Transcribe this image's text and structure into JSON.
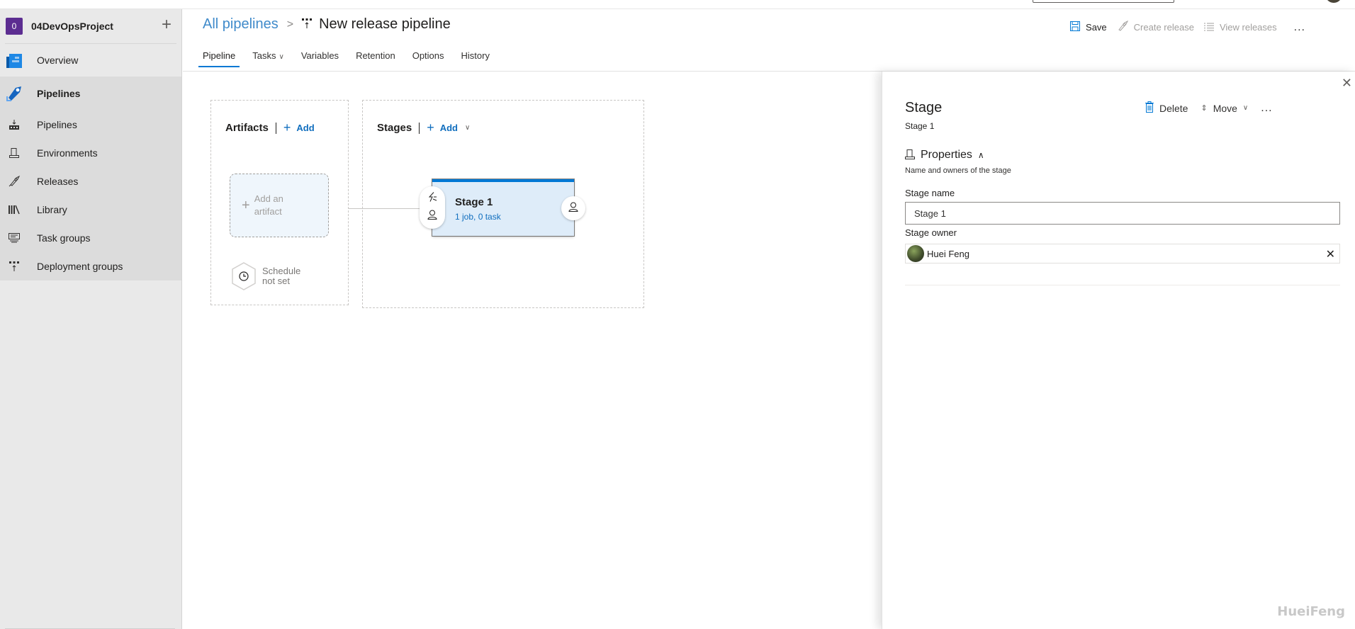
{
  "project": {
    "initial": "0",
    "name": "04DevOpsProject",
    "add_icon": "plus-icon"
  },
  "sidebar": {
    "overview": {
      "label": "Overview",
      "icon": "overview-icon"
    },
    "pipelines_group": {
      "label": "Pipelines",
      "icon": "pipelines-rocket-icon",
      "items": [
        {
          "label": "Pipelines",
          "icon": "pipelines-icon"
        },
        {
          "label": "Environments",
          "icon": "environments-icon"
        },
        {
          "label": "Releases",
          "icon": "rocket-icon"
        },
        {
          "label": "Library",
          "icon": "library-icon"
        },
        {
          "label": "Task groups",
          "icon": "task-groups-icon"
        },
        {
          "label": "Deployment groups",
          "icon": "deployment-groups-icon"
        }
      ]
    }
  },
  "header": {
    "breadcrumb_root": "All pipelines",
    "breadcrumb_separator": ">",
    "title": "New release pipeline",
    "tabs": [
      {
        "label": "Pipeline",
        "active": true
      },
      {
        "label": "Tasks",
        "has_dropdown": true
      },
      {
        "label": "Variables"
      },
      {
        "label": "Retention"
      },
      {
        "label": "Options"
      },
      {
        "label": "History"
      }
    ],
    "actions": {
      "save": "Save",
      "create_release": "Create release",
      "view_releases": "View releases",
      "more": "..."
    }
  },
  "canvas": {
    "artifacts": {
      "title": "Artifacts",
      "add_label": "Add",
      "placeholder_line1": "Add an",
      "placeholder_line2": "artifact",
      "schedule_line1": "Schedule",
      "schedule_line2": "not set"
    },
    "stages": {
      "title": "Stages",
      "add_label": "Add",
      "stage": {
        "name": "Stage 1",
        "summary": "1 job, 0 task"
      }
    }
  },
  "panel": {
    "title": "Stage",
    "subtitle": "Stage 1",
    "actions": {
      "delete": "Delete",
      "move": "Move",
      "more": "..."
    },
    "section": {
      "title": "Properties",
      "description": "Name and owners of the stage"
    },
    "fields": {
      "stage_name_label": "Stage name",
      "stage_name_value": "Stage 1",
      "stage_owner_label": "Stage owner",
      "stage_owner_value": "Huei Feng"
    }
  },
  "watermark": "HueiFeng",
  "colors": {
    "accent": "#0078d4",
    "project_badge": "#5c2d91",
    "stage_card_bg": "#deecf9",
    "sidebar_bg": "#e9e9e9"
  }
}
